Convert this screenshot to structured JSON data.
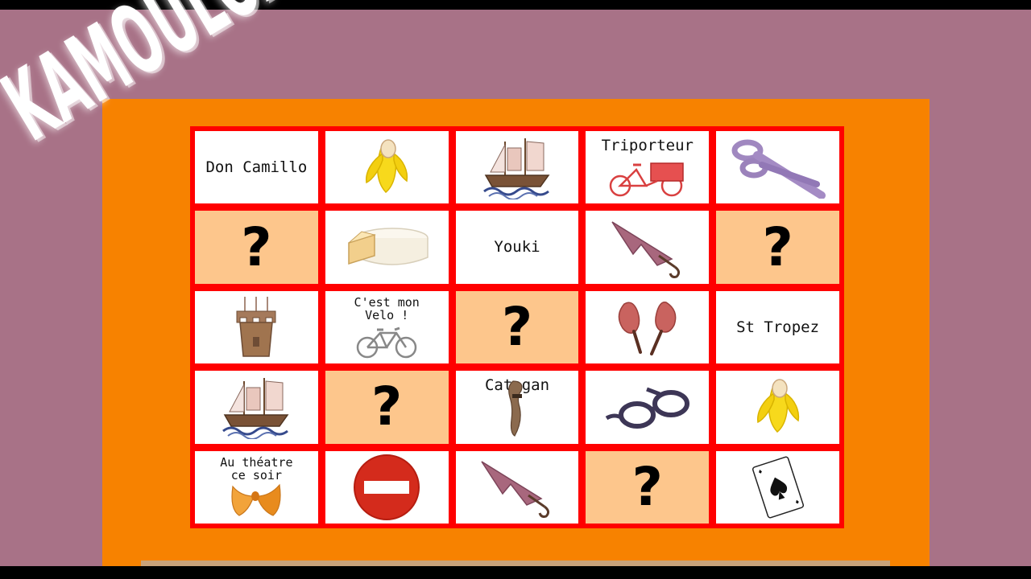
{
  "app": {
    "logo_text": "KAMOULOX"
  },
  "colors": {
    "background": "#a87287",
    "board": "#f78200",
    "grid_border": "#ff0000",
    "card": "#ffffff",
    "hidden_card": "#fdc68c"
  },
  "grid": {
    "rows": [
      [
        {
          "type": "text",
          "label": "Don Camillo"
        },
        {
          "type": "icon",
          "icon": "banana-icon"
        },
        {
          "type": "icon",
          "icon": "sailboat-icon"
        },
        {
          "type": "text-icon",
          "label": "Triporteur",
          "icon": "cargo-bike-icon"
        },
        {
          "type": "icon",
          "icon": "scissors-icon"
        }
      ],
      [
        {
          "type": "hidden",
          "label": "?"
        },
        {
          "type": "icon",
          "icon": "cheese-icon"
        },
        {
          "type": "text",
          "label": "Youki"
        },
        {
          "type": "icon",
          "icon": "umbrella-icon"
        },
        {
          "type": "hidden",
          "label": "?"
        }
      ],
      [
        {
          "type": "icon",
          "icon": "tower-icon"
        },
        {
          "type": "text-icon",
          "label": "C'est mon Velo !",
          "icon": "bicycle-icon"
        },
        {
          "type": "hidden",
          "label": "?"
        },
        {
          "type": "icon",
          "icon": "drumsticks-icon"
        },
        {
          "type": "text",
          "label": "St Tropez"
        }
      ],
      [
        {
          "type": "icon",
          "icon": "sailboat-icon"
        },
        {
          "type": "hidden",
          "label": "?"
        },
        {
          "type": "text-icon",
          "label": "Catogan",
          "icon": "ponytail-icon"
        },
        {
          "type": "icon",
          "icon": "glasses-icon"
        },
        {
          "type": "icon",
          "icon": "banana-icon"
        }
      ],
      [
        {
          "type": "text-icon",
          "label": "Au théatre ce soir",
          "icon": "bowtie-icon"
        },
        {
          "type": "icon",
          "icon": "no-entry-icon"
        },
        {
          "type": "icon",
          "icon": "umbrella-icon"
        },
        {
          "type": "hidden",
          "label": "?"
        },
        {
          "type": "icon",
          "icon": "ace-of-spades-icon"
        }
      ]
    ]
  }
}
